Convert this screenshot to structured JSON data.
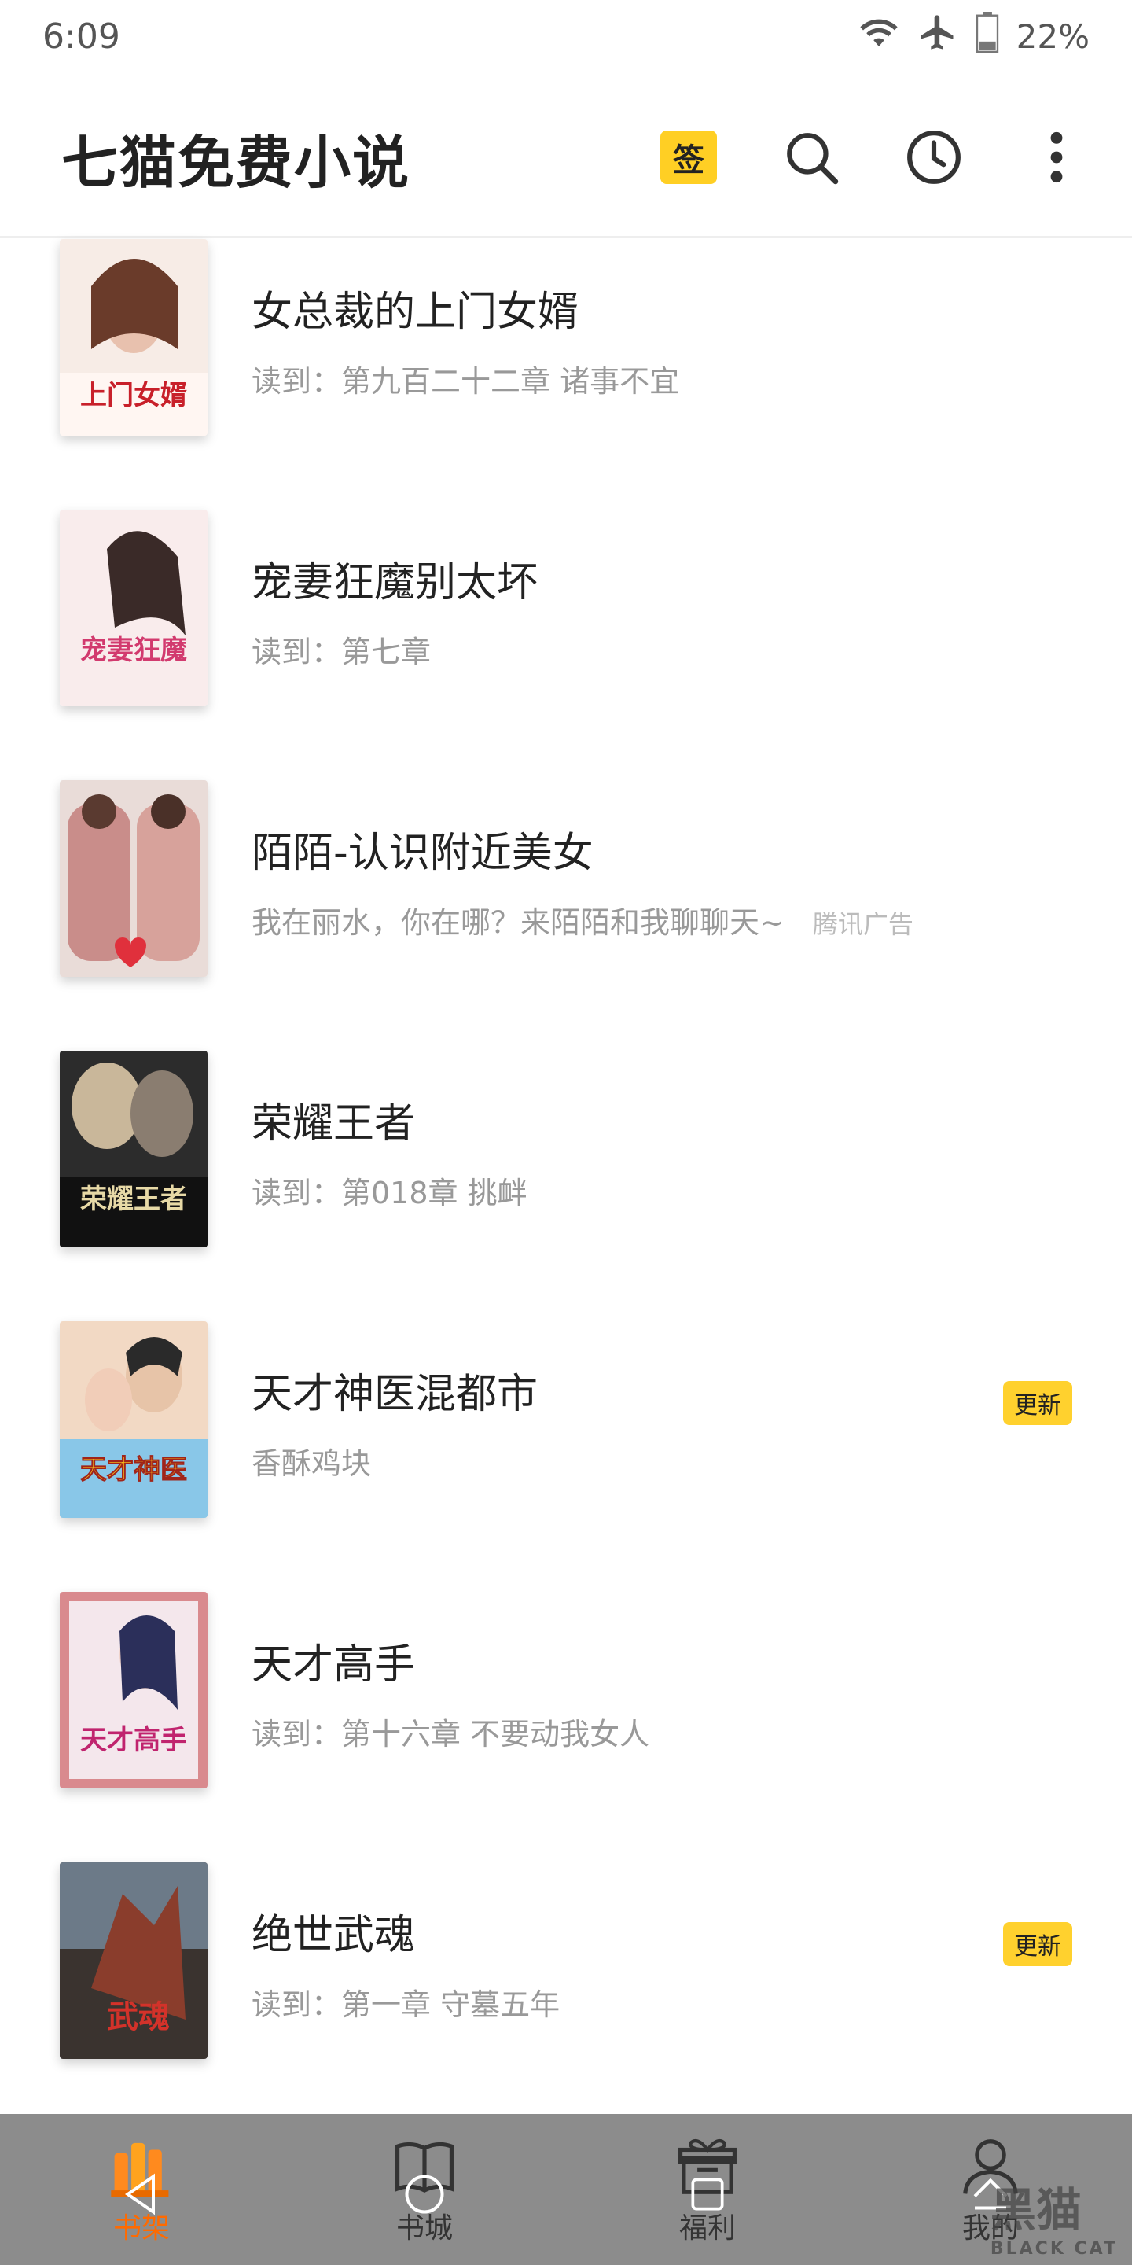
{
  "status_bar": {
    "time": "6:09",
    "battery": "22%"
  },
  "app_bar": {
    "title": "七猫免费小说",
    "sign_label": "签"
  },
  "books": [
    {
      "title": "女总裁的上门女婿",
      "subtitle": "读到：第九百二十二章 诸事不宜",
      "badge": "",
      "ad": "",
      "cover_text": "上门女婿",
      "cover_color": "#f3e6e0"
    },
    {
      "title": "宠妻狂魔别太坏",
      "subtitle": "读到：第七章",
      "badge": "",
      "ad": "",
      "cover_text": "宠妻狂魔",
      "cover_color": "#f6e4e4"
    },
    {
      "title": "陌陌-认识附近美女",
      "subtitle": "我在丽水，你在哪？来陌陌和我聊聊天~",
      "badge": "",
      "ad": "腾讯广告",
      "cover_text": "",
      "cover_color": "#d9c6c4"
    },
    {
      "title": "荣耀王者",
      "subtitle": "读到：第018章 挑衅",
      "badge": "",
      "ad": "",
      "cover_text": "荣耀王者",
      "cover_color": "#3b3b3b"
    },
    {
      "title": "天才神医混都市",
      "subtitle": "香酥鸡块",
      "badge": "更新",
      "ad": "",
      "cover_text": "天才神医",
      "cover_color": "#e7a77a"
    },
    {
      "title": "天才高手",
      "subtitle": "读到：第十六章 不要动我女人",
      "badge": "",
      "ad": "",
      "cover_text": "天才高手",
      "cover_color": "#d98a8e"
    },
    {
      "title": "绝世武魂",
      "subtitle": "读到：第一章 守墓五年",
      "badge": "更新",
      "ad": "",
      "cover_text": "武魂",
      "cover_color": "#4a3c36"
    }
  ],
  "bottom_nav": {
    "tabs": [
      {
        "label": "书架",
        "icon": "bookshelf-icon",
        "active": true
      },
      {
        "label": "书城",
        "icon": "book-open-icon",
        "active": false
      },
      {
        "label": "福利",
        "icon": "gift-icon",
        "active": false
      },
      {
        "label": "我的",
        "icon": "person-icon",
        "active": false
      }
    ]
  },
  "watermark": {
    "text": "黑猫",
    "sub": "BLACK CAT"
  },
  "colors": {
    "accent": "#ffcf24",
    "active_tab": "#ff6a00",
    "nav_bg": "#8c8c8c"
  }
}
